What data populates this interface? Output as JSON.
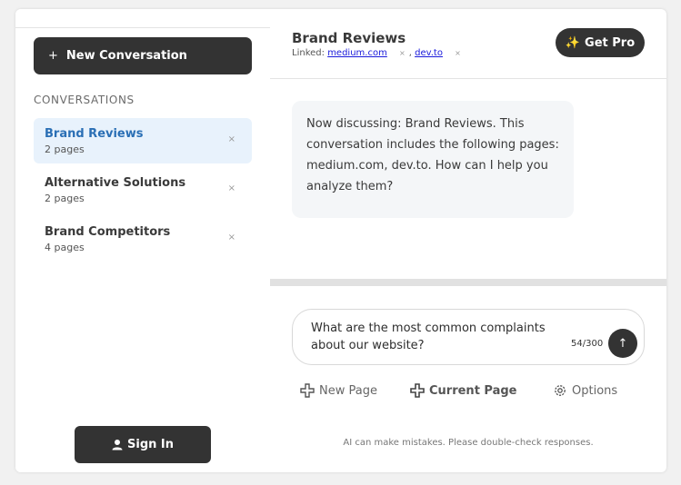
{
  "sidebar": {
    "new_conversation_label": "New Conversation",
    "new_conversation_icon": "+",
    "section_heading": "CONVERSATIONS",
    "conversations": [
      {
        "title": "Brand Reviews",
        "pages": "2 pages",
        "close": "×"
      },
      {
        "title": "Alternative Solutions",
        "pages": "2 pages",
        "close": "×"
      },
      {
        "title": "Brand Competitors",
        "pages": "4 pages",
        "close": "×"
      }
    ],
    "sign_in_label": "Sign In"
  },
  "header": {
    "title": "Brand Reviews",
    "linked_label": "Linked:",
    "linked_pages": [
      {
        "label": "medium.com",
        "close": "×"
      },
      {
        "label": "dev.to",
        "close": "×"
      }
    ],
    "separator": ",",
    "get_pro_label": "Get Pro",
    "get_pro_icon": "✨"
  },
  "chat": {
    "assistant_message": "Now discussing: Brand Reviews. This conversation includes the following pages: medium.com, dev.to. How can I help you analyze them?"
  },
  "composer": {
    "value": "What are the most common complaints about our website?",
    "counter": "54/300",
    "send_icon": "↑"
  },
  "actions": {
    "new_page": "New Page",
    "current_page": "Current Page",
    "options": "Options"
  },
  "footer": {
    "disclaimer": "AI can make mistakes. Please double-check responses."
  },
  "colors": {
    "dark_button": "#333333",
    "active_item_bg": "#e8f2fc",
    "active_item_text": "#2a6fb5",
    "link": "#1a1adb",
    "bubble_bg": "#f4f6f8"
  }
}
